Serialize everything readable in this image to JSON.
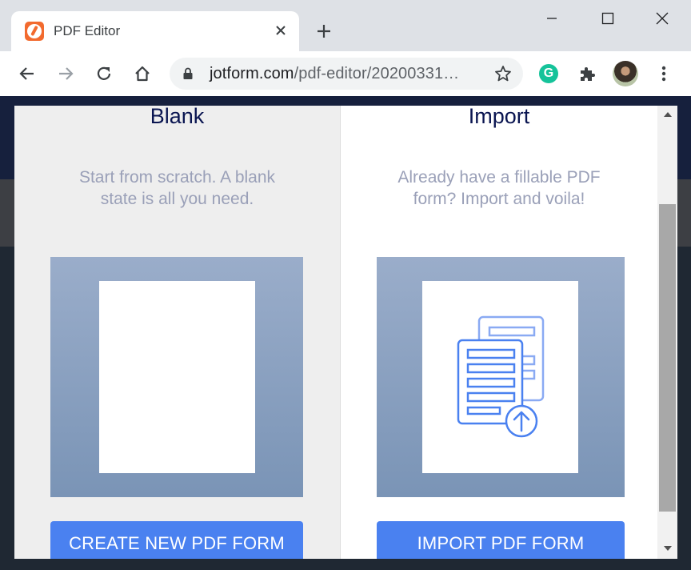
{
  "browser": {
    "tab_title": "PDF Editor",
    "url_domain": "jotform.com",
    "url_path": "/pdf-editor/20200331…"
  },
  "modal": {
    "blank": {
      "title": "Blank",
      "description": "Start from scratch. A blank state is all you need.",
      "button_label": "CREATE NEW PDF FORM"
    },
    "import": {
      "title": "Import",
      "description": "Already have a fillable PDF form? Import and voila!",
      "button_label": "IMPORT PDF FORM"
    }
  },
  "colors": {
    "accent": "#4a81f0",
    "title_text": "#0a1551",
    "desc_text": "#9aa0b8",
    "favicon": "#f26a2e",
    "grammarly": "#15c39a"
  }
}
